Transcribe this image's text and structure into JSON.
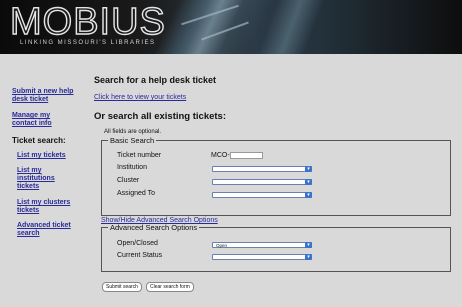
{
  "banner": {
    "logo_text": "MOBIUS",
    "tagline": "LINKING MISSOURI'S LIBRARIES"
  },
  "sidebar": {
    "submit_link": "Submit a new help desk ticket",
    "manage_link": "Manage my contact info",
    "ticket_search_heading": "Ticket search:",
    "items": [
      {
        "label": "List my tickets"
      },
      {
        "label": "List my institutions tickets"
      },
      {
        "label": "List my clusters tickets"
      },
      {
        "label": "Advanced ticket search"
      }
    ]
  },
  "main": {
    "title": "Search for a help desk ticket",
    "view_link": "Click here to view your tickets",
    "search_all_heading": "Or search all existing tickets:",
    "optional_note": "All fields are optional.",
    "basic": {
      "legend": "Basic Search",
      "ticket_label": "Ticket number",
      "ticket_prefix": "MCO-",
      "ticket_value": "",
      "institution_label": "Institution",
      "institution_value": "",
      "cluster_label": "Cluster",
      "cluster_value": "",
      "assigned_label": "Assigned To",
      "assigned_value": ""
    },
    "toggle_advanced_link": "Show/Hide Advanced Search Options",
    "advanced": {
      "legend": "Advanced Search Options",
      "open_closed_label": "Open/Closed",
      "open_closed_value": "Open",
      "status_label": "Current Status",
      "status_value": ""
    },
    "submit_label": "Submit search",
    "clear_label": "Clear search form"
  },
  "colors": {
    "page_bg": "#d9d9d9",
    "link": "#2a2a9a",
    "select_arrow": "#3c74c7"
  }
}
